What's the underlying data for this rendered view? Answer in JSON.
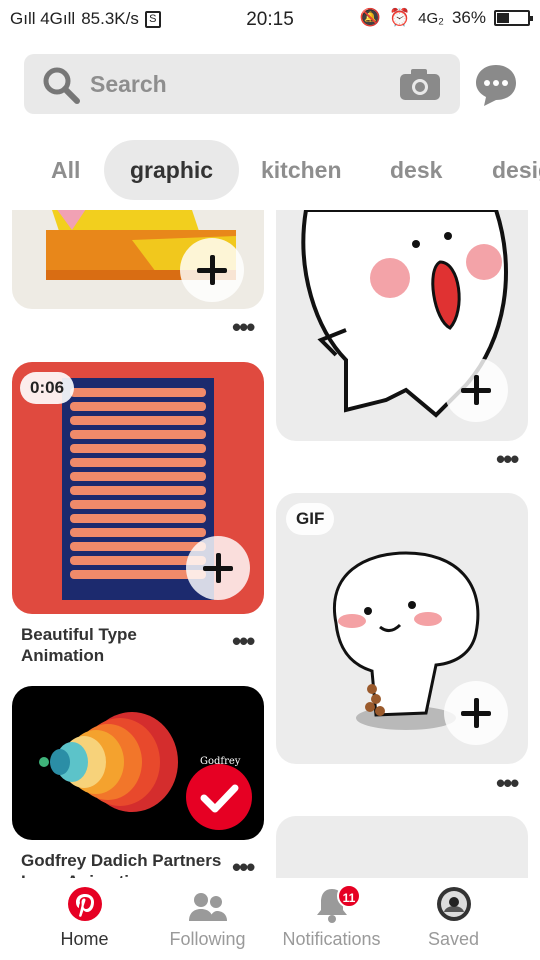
{
  "status_bar": {
    "signal_text": "Gıll 4Gıll",
    "speed": "85.3K/s",
    "time": "20:15",
    "network": "4G₂",
    "battery": "36%",
    "battery_level": 0.36
  },
  "search": {
    "placeholder": "Search"
  },
  "tabs": [
    {
      "label": "All"
    },
    {
      "label": "graphic",
      "active": true
    },
    {
      "label": "kitchen"
    },
    {
      "label": "desk"
    },
    {
      "label": "desig"
    }
  ],
  "pins": {
    "video_badge": "0:06",
    "gif_badge": "GIF",
    "beautiful_type_title": "Beautiful Type Animation",
    "godfrey_title": "Godfrey Dadich Partners Logo Animation"
  },
  "bottom_nav": {
    "home": "Home",
    "following": "Following",
    "notifications": "Notifications",
    "notifications_count": "11",
    "saved": "Saved"
  },
  "colors": {
    "brand": "#e60023",
    "pin_red": "#e04a3f"
  }
}
